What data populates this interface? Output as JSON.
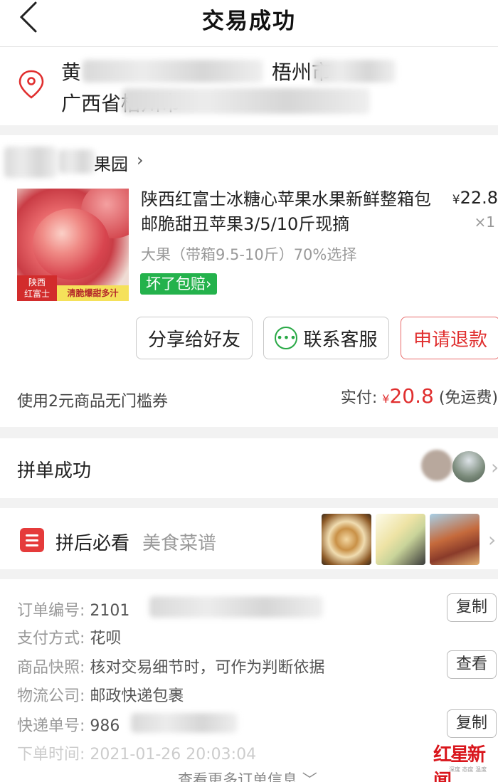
{
  "header": {
    "title": "交易成功"
  },
  "address": {
    "line1_name": "黄",
    "line1_city": "梧州市",
    "line2": "广西省梧州市"
  },
  "shop": {
    "name": "果园",
    "chevron": "›"
  },
  "product": {
    "title": "陕西红富士冰糖心苹果水果新鲜整箱包邮脆甜丑苹果3/5/10斤现摘",
    "currency": "¥",
    "price": "22.8",
    "qty": "×1",
    "spec": "大果（带箱9.5-10斤）70%选择",
    "guarantee": "坏了包赔",
    "guarantee_chevron": "›",
    "image_tag_left": "陕西\n红富士",
    "image_tag_right": "清脆爆甜多汁"
  },
  "actions": {
    "share": "分享给好友",
    "service": "联系客服",
    "refund": "申请退款"
  },
  "summary": {
    "coupon": "使用2元商品无门槛券",
    "paid_label": "实付:",
    "currency": "¥",
    "paid_amount": "20.8",
    "shipping": "(免运费)"
  },
  "group_buy": {
    "title": "拼单成功"
  },
  "recipe": {
    "title": "拼后必看",
    "subtitle": "美食菜谱"
  },
  "order_info": {
    "order_no_label": "订单编号:",
    "order_no": "2101",
    "copy_label": "复制",
    "payment_label": "支付方式:",
    "payment": "花呗",
    "snapshot_label": "商品快照:",
    "snapshot": "核对交易细节时，可作为判断依据",
    "view_label": "查看",
    "logistics_label": "物流公司:",
    "logistics": "邮政快递包裹",
    "tracking_label": "快递单号:",
    "tracking": "986",
    "time_label": "下单时间:",
    "time": "2021-01-26 20:03:04",
    "more": "查看更多订单信息"
  },
  "watermark": {
    "main": "红星新闻",
    "sub": "深度 态度 温度"
  },
  "colors": {
    "accent_red": "#e02e2e",
    "guarantee_green": "#24b24c",
    "chat_green": "#27a844"
  }
}
